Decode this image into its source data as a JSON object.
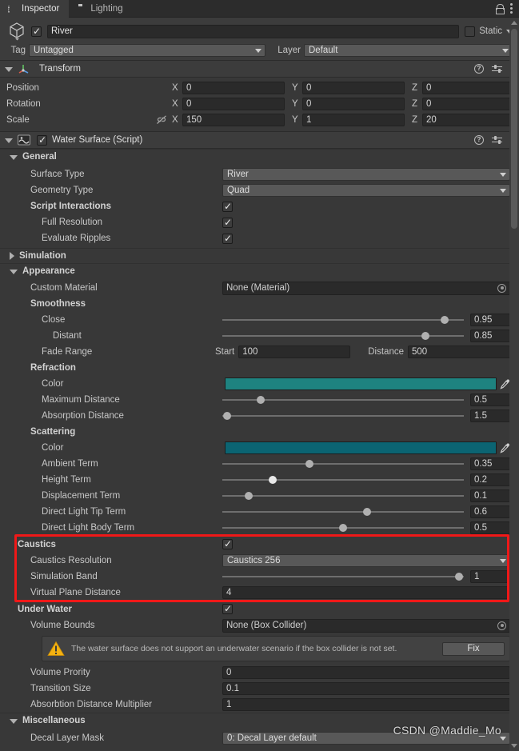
{
  "window": {
    "tabs": [
      {
        "label": "Inspector",
        "icon": "info-icon",
        "active": true
      },
      {
        "label": "Lighting",
        "icon": "lightbulb-icon",
        "active": false
      }
    ],
    "lock_icon": "lock-icon",
    "menu_icon": "kebab-menu-icon"
  },
  "object_header": {
    "enabled": true,
    "name": "River",
    "static_label": "Static",
    "static_checked": false,
    "tag_label": "Tag",
    "tag_value": "Untagged",
    "layer_label": "Layer",
    "layer_value": "Default"
  },
  "transform": {
    "title": "Transform",
    "expanded": true,
    "rows": [
      {
        "label": "Position",
        "x": "0",
        "y": "0",
        "z": "0",
        "unlinked": false
      },
      {
        "label": "Rotation",
        "x": "0",
        "y": "0",
        "z": "0",
        "unlinked": false
      },
      {
        "label": "Scale",
        "x": "150",
        "y": "1",
        "z": "20",
        "unlinked": true
      }
    ],
    "axis_labels": {
      "x": "X",
      "y": "Y",
      "z": "Z"
    }
  },
  "water_surface": {
    "title": "Water Surface (Script)",
    "enabled": true,
    "general": {
      "title": "General",
      "expanded": true,
      "surface_type_label": "Surface Type",
      "surface_type_value": "River",
      "geometry_type_label": "Geometry Type",
      "geometry_type_value": "Quad",
      "script_interactions_label": "Script Interactions",
      "script_interactions_checked": true,
      "full_resolution_label": "Full Resolution",
      "full_resolution_checked": true,
      "evaluate_ripples_label": "Evaluate Ripples",
      "evaluate_ripples_checked": true
    },
    "simulation": {
      "title": "Simulation",
      "expanded": false
    },
    "appearance": {
      "title": "Appearance",
      "expanded": true,
      "custom_material_label": "Custom Material",
      "custom_material_value": "None (Material)",
      "smoothness_label": "Smoothness",
      "close_label": "Close",
      "close_value": "0.95",
      "close_pct": 92,
      "distant_label": "Distant",
      "distant_value": "0.85",
      "distant_pct": 84,
      "fade_range_label": "Fade Range",
      "fade_start_label": "Start",
      "fade_start_value": "100",
      "fade_distance_label": "Distance",
      "fade_distance_value": "500",
      "refraction_label": "Refraction",
      "refraction_color_label": "Color",
      "refraction_color": "#1e8380",
      "max_distance_label": "Maximum Distance",
      "max_distance_value": "0.5",
      "max_distance_pct": 16,
      "absorption_distance_label": "Absorption Distance",
      "absorption_distance_value": "1.5",
      "absorption_distance_pct": 2,
      "scattering_label": "Scattering",
      "scattering_color_label": "Color",
      "scattering_color": "#0b6472",
      "ambient_term_label": "Ambient Term",
      "ambient_term_value": "0.35",
      "ambient_term_pct": 36,
      "height_term_label": "Height Term",
      "height_term_value": "0.2",
      "height_term_pct": 21,
      "displacement_term_label": "Displacement Term",
      "displacement_term_value": "0.1",
      "displacement_term_pct": 11,
      "direct_light_tip_label": "Direct Light Tip Term",
      "direct_light_tip_value": "0.6",
      "direct_light_tip_pct": 60,
      "direct_light_body_label": "Direct Light Body Term",
      "direct_light_body_value": "0.5",
      "direct_light_body_pct": 50
    },
    "caustics": {
      "title": "Caustics",
      "enabled": true,
      "resolution_label": "Caustics Resolution",
      "resolution_value": "Caustics 256",
      "simulation_band_label": "Simulation Band",
      "simulation_band_value": "1",
      "simulation_band_pct": 98,
      "virtual_plane_label": "Virtual Plane Distance",
      "virtual_plane_value": "4",
      "highlight_color": "#f01818"
    },
    "under_water": {
      "title": "Under Water",
      "enabled": true,
      "volume_bounds_label": "Volume Bounds",
      "volume_bounds_value": "None (Box Collider)",
      "warning_text": "The water surface does not support an underwater scenario if the box collider is not set.",
      "warning_icon": "warning-triangle-icon",
      "warning_color": "#f5b211",
      "fix_button_label": "Fix",
      "volume_priority_label": "Volume Prority",
      "volume_priority_value": "0",
      "transition_size_label": "Transition Size",
      "transition_size_value": "0.1",
      "absorption_multiplier_label": "Absorbtion Distance Multiplier",
      "absorption_multiplier_value": "1"
    },
    "miscellaneous": {
      "title": "Miscellaneous",
      "expanded": true,
      "decal_layer_mask_label": "Decal Layer Mask",
      "decal_layer_mask_value": "0: Decal Layer default"
    }
  },
  "watermark": "CSDN @Maddie_Mo"
}
